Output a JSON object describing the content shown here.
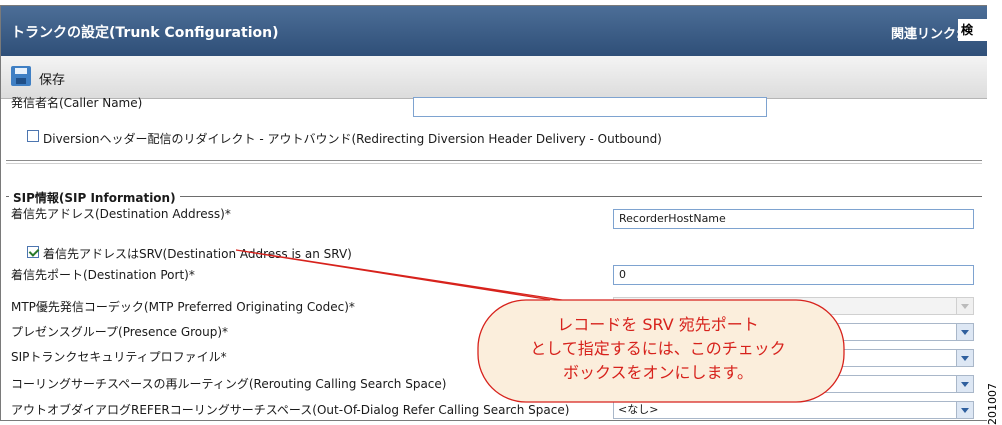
{
  "header": {
    "title": "トランクの設定(Trunk Configuration)",
    "related_links_label": "関連リンク:",
    "related_links_value": "検"
  },
  "toolbar": {
    "save_label": "保存"
  },
  "fields": {
    "caller_name_label": "発信者名(Caller Name)",
    "diversion_label": "Diversionヘッダー配信のリダイレクト - アウトバウンド(Redirecting Diversion Header Delivery - Outbound)"
  },
  "sip": {
    "legend": "SIP情報(SIP Information)",
    "destination_address_label": "着信先アドレス(Destination Address)*",
    "destination_address_value": "RecorderHostName",
    "is_srv_label": "着信先アドレスはSRV(Destination Address is an SRV)",
    "destination_port_label": "着信先ポート(Destination Port)*",
    "destination_port_value": "0",
    "mtp_label": "MTP優先発信コーデック(MTP Preferred Originating Codec)*",
    "presence_group_label": "プレゼンスグループ(Presence Group)*",
    "security_profile_label": "SIPトランクセキュリティプロファイル*",
    "rerouting_css_label": "コーリングサーチスペースの再ルーティング(Rerouting Calling Search Space)",
    "ood_refer_css_label": "アウトオブダイアログREFERコーリングサーチスペース(Out-Of-Dialog Refer Calling Search Space)",
    "ood_refer_css_value": "<なし>"
  },
  "callout": {
    "line1": "レコードを SRV 宛先ポート",
    "line2": "として指定するには、このチェック",
    "line3": "ボックスをオンにします。"
  },
  "watermark": "201007",
  "colors": {
    "header_blue": "#2f4f78",
    "callout_red": "#d7221c",
    "callout_fill": "#fbeedc"
  }
}
